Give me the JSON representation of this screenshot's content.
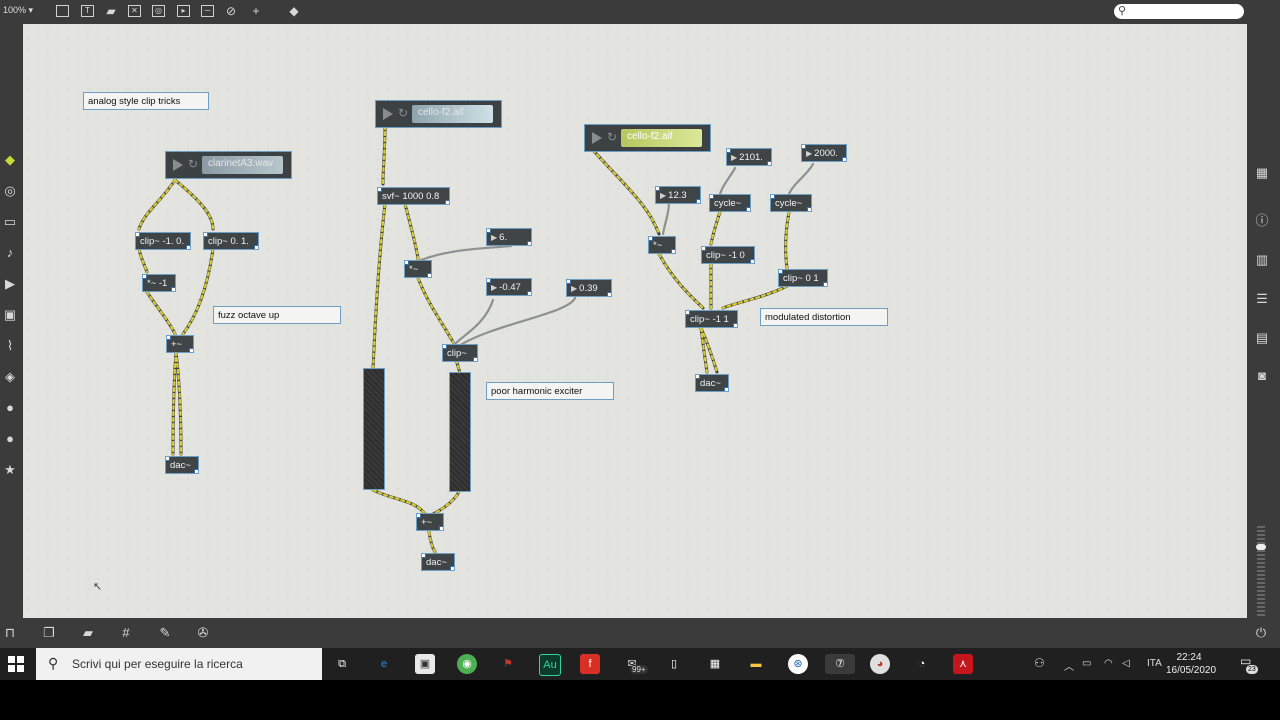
{
  "toolbar": {
    "zoom": "100% ▾"
  },
  "comments": {
    "c1": "analog style clip tricks",
    "c2": "fuzz octave up",
    "c3": "poor harmonic exciter",
    "c4": "modulated distortion"
  },
  "players": {
    "p1": "clarinetA3.wav",
    "p2": "cello-f2.aif",
    "p3": "cello-f2.aif"
  },
  "objects": {
    "clip_a": "clip~ -1. 0.",
    "clip_b": "clip~ 0. 1.",
    "mul_a": "*~ -1",
    "plus_a": "+~",
    "dac_a": "dac~",
    "svf": "svf~ 1000 0.8",
    "mul_b": "*~",
    "clip_c": "clip~",
    "plus_b": "+~",
    "dac_b": "dac~",
    "mul_c": "*~",
    "cycle_a": "cycle~",
    "cycle_b": "cycle~",
    "clip_d": "clip~ -1 0",
    "clip_e": "clip~ 0 1",
    "clip_f": "clip~ -1 1",
    "dac_c": "dac~"
  },
  "numbers": {
    "n6": "6.",
    "n047": "-0.47",
    "n039": "0.39",
    "n123": "12.3",
    "n2101": "2101.",
    "n2000": "2000."
  },
  "taskbar": {
    "search_placeholder": "Scrivi qui per eseguire la ricerca",
    "lang": "ITA",
    "time": "22:24",
    "date": "16/05/2020",
    "notif_count": "23",
    "mail_badge": "99+"
  },
  "colors": {
    "canvas": "#e3e3df",
    "object": "#3f4447",
    "selection": "#6d9fc6",
    "cord": "#c8c13a"
  }
}
